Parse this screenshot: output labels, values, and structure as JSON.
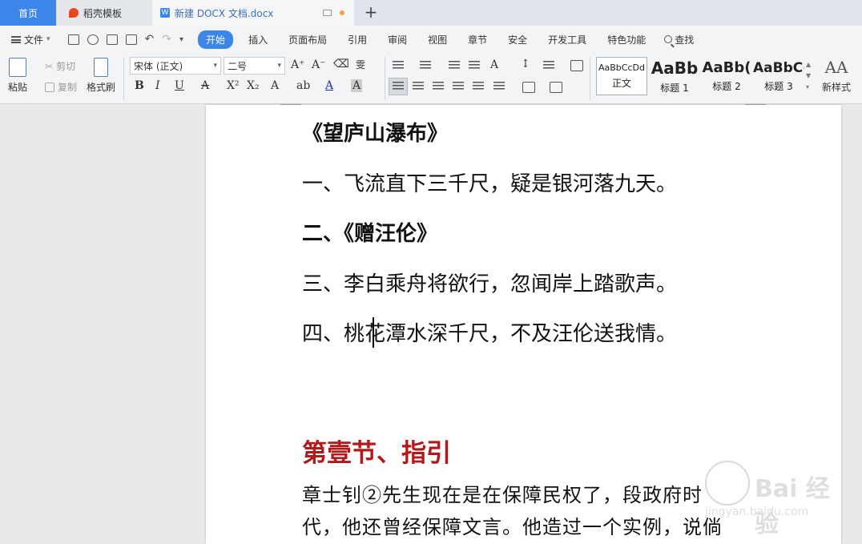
{
  "tabs": {
    "home": "首页",
    "template": "稻壳模板",
    "document": "新建 DOCX 文档.docx",
    "new_tab": "+"
  },
  "menu": {
    "file": "文件",
    "items": [
      "开始",
      "插入",
      "页面布局",
      "引用",
      "审阅",
      "视图",
      "章节",
      "安全",
      "开发工具",
      "特色功能"
    ],
    "search": "查找"
  },
  "ribbon": {
    "paste": "粘贴",
    "cut": "剪切",
    "copy": "复制",
    "format_painter": "格式刷",
    "font_name": "宋体 (正文)",
    "font_size": "二号",
    "styles": [
      {
        "sample": "AaBbCcDd",
        "label": "正文"
      },
      {
        "sample": "AaBb",
        "label": "标题 1"
      },
      {
        "sample": "AaBb(",
        "label": "标题 2"
      },
      {
        "sample": "AaBbC(",
        "label": "标题 3"
      }
    ],
    "new_style": "新样式"
  },
  "document": {
    "title": "《望庐山瀑布》",
    "line1": "一、飞流直下三千尺，疑是银河落九天。",
    "line2": "二、《赠汪伦》",
    "line3": "三、李白乘舟将欲行，忽闻岸上踏歌声。",
    "line4": "四、桃花潭水深千尺，不及汪伦送我情。",
    "heading": "第壹节、指引",
    "para1": " 章士钊②先生现在是在保障民权了，段政府时",
    "para2": "代，他还曾经保障文言。他造过一个实例，说倘"
  },
  "watermark": {
    "text": "Bai 经验",
    "url": "jingyan.baidu.com"
  },
  "colors": {
    "accent": "#3b86e8",
    "heading_red": "#b01a1a"
  }
}
